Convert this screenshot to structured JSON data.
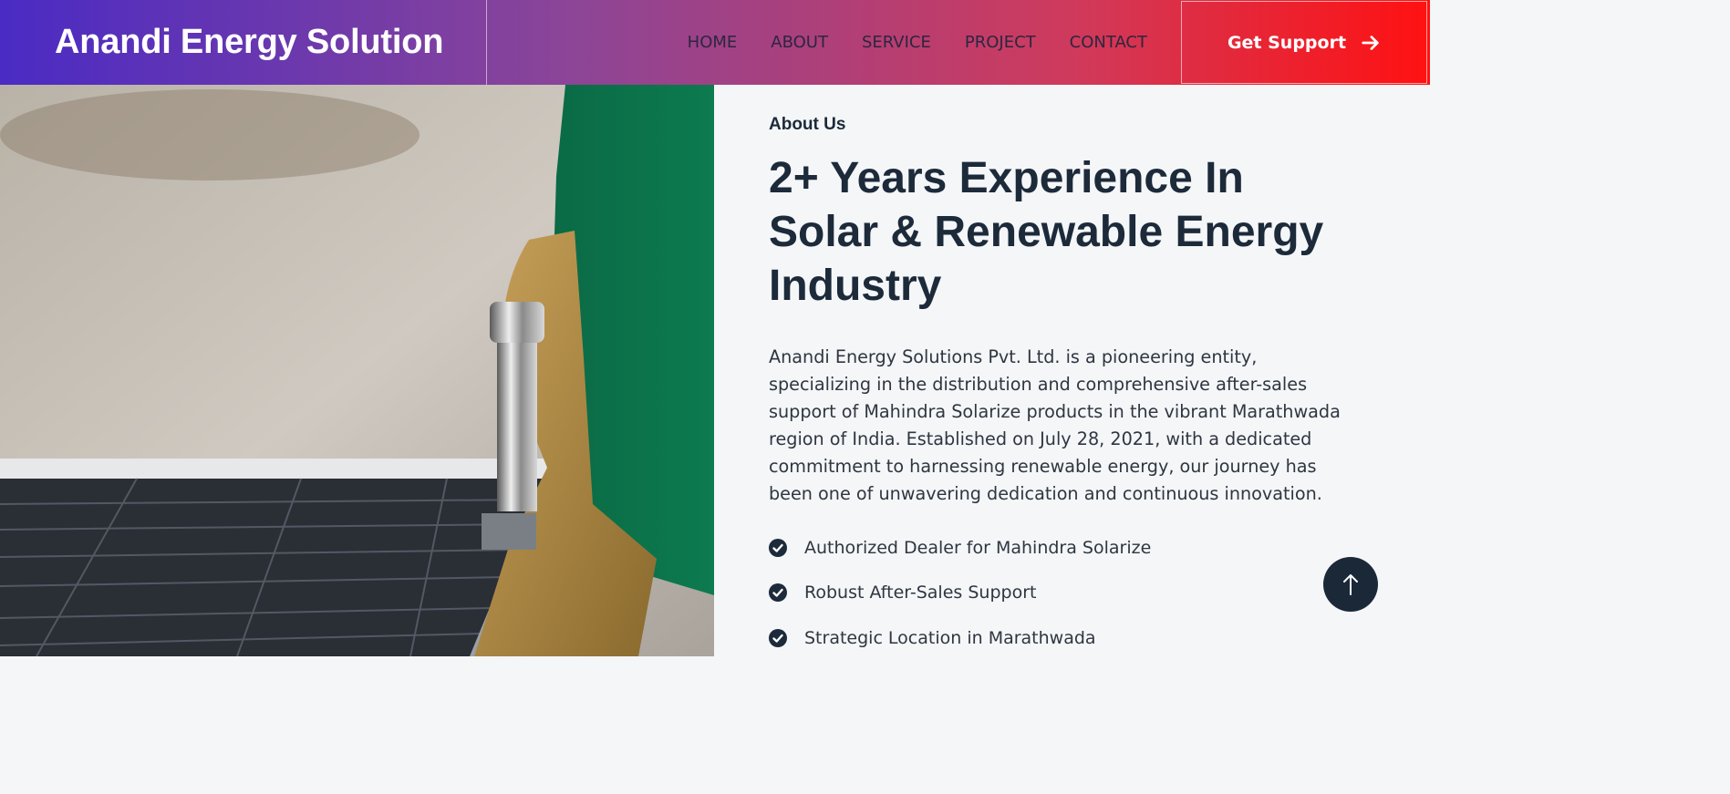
{
  "brand": {
    "name": "Anandi Energy Solution"
  },
  "nav": {
    "items": [
      {
        "label": "HOME"
      },
      {
        "label": "ABOUT"
      },
      {
        "label": "SERVICE"
      },
      {
        "label": "PROJECT"
      },
      {
        "label": "CONTACT"
      }
    ],
    "cta_label": "Get Support",
    "cta_icon": "arrow-right-icon"
  },
  "hero_image": {
    "subject": "solar-panel-installation-photo"
  },
  "about": {
    "kicker": "About Us",
    "headline": "2+ Years Experience In Solar & Renewable Energy Industry",
    "description": "Anandi Energy Solutions Pvt. Ltd. is a pioneering entity, specializing in the distribution and comprehensive after-sales support of Mahindra Solarize products in the vibrant Marathwada region of India. Established on July 28, 2021, with a dedicated commitment to harnessing renewable energy, our journey has been one of unwavering dedication and continuous innovation.",
    "features": [
      {
        "label": "Authorized Dealer for Mahindra Solarize",
        "icon": "check-circle-icon"
      },
      {
        "label": "Robust After-Sales Support",
        "icon": "check-circle-icon"
      },
      {
        "label": "Strategic Location in Marathwada",
        "icon": "check-circle-icon"
      }
    ]
  },
  "back_to_top": {
    "icon": "arrow-up-icon"
  },
  "colors": {
    "gradient_start": "#4a2bc4",
    "gradient_end": "#ff1111",
    "heading": "#1c2a3a",
    "body_text": "#2f3640",
    "back_to_top_bg": "#1b2838"
  }
}
